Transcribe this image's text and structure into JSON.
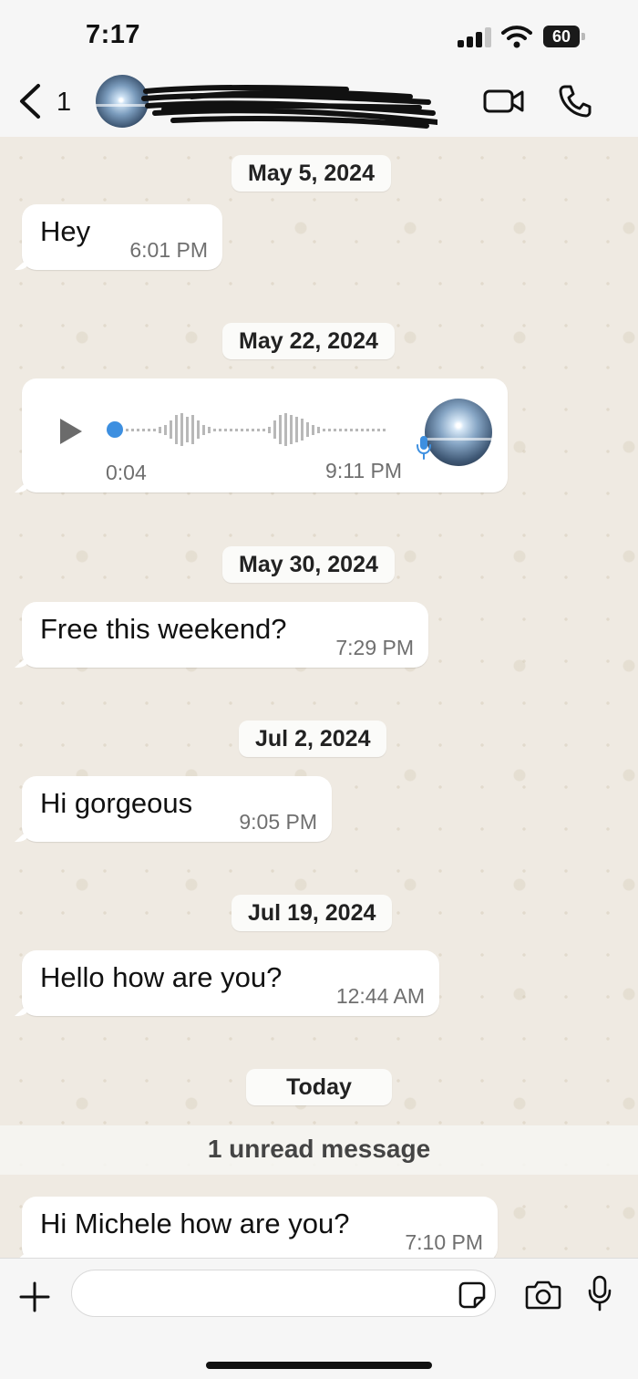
{
  "status_bar": {
    "time": "7:17",
    "battery": "60"
  },
  "header": {
    "back_count": "1",
    "icons": [
      "chevron-left-icon",
      "video-call-icon",
      "phone-icon"
    ]
  },
  "chat": {
    "date_labels": [
      "May 5, 2024",
      "May 22, 2024",
      "May 30, 2024",
      "Jul 2, 2024",
      "Jul 19, 2024",
      "Today"
    ],
    "messages": [
      {
        "text": "Hey",
        "time": "6:01 PM"
      },
      {
        "text": "Free this weekend?",
        "time": "7:29 PM"
      },
      {
        "text": "Hi gorgeous",
        "time": "9:05 PM"
      },
      {
        "text": "Hello how are you?",
        "time": "12:44 AM"
      },
      {
        "text": "Hi Michele how are you?",
        "time": "7:10 PM"
      }
    ],
    "voice_message": {
      "duration": "0:04",
      "time": "9:11 PM"
    },
    "unread_label": "1 unread message"
  },
  "input_bar": {
    "placeholder": "",
    "icons": [
      "plus-icon",
      "sticker-icon",
      "camera-icon",
      "microphone-icon"
    ]
  },
  "colors": {
    "chat_background": "#efeae2",
    "bubble": "#ffffff",
    "voice_progress": "#3d8fe0",
    "bar_background": "#f6f6f6"
  }
}
